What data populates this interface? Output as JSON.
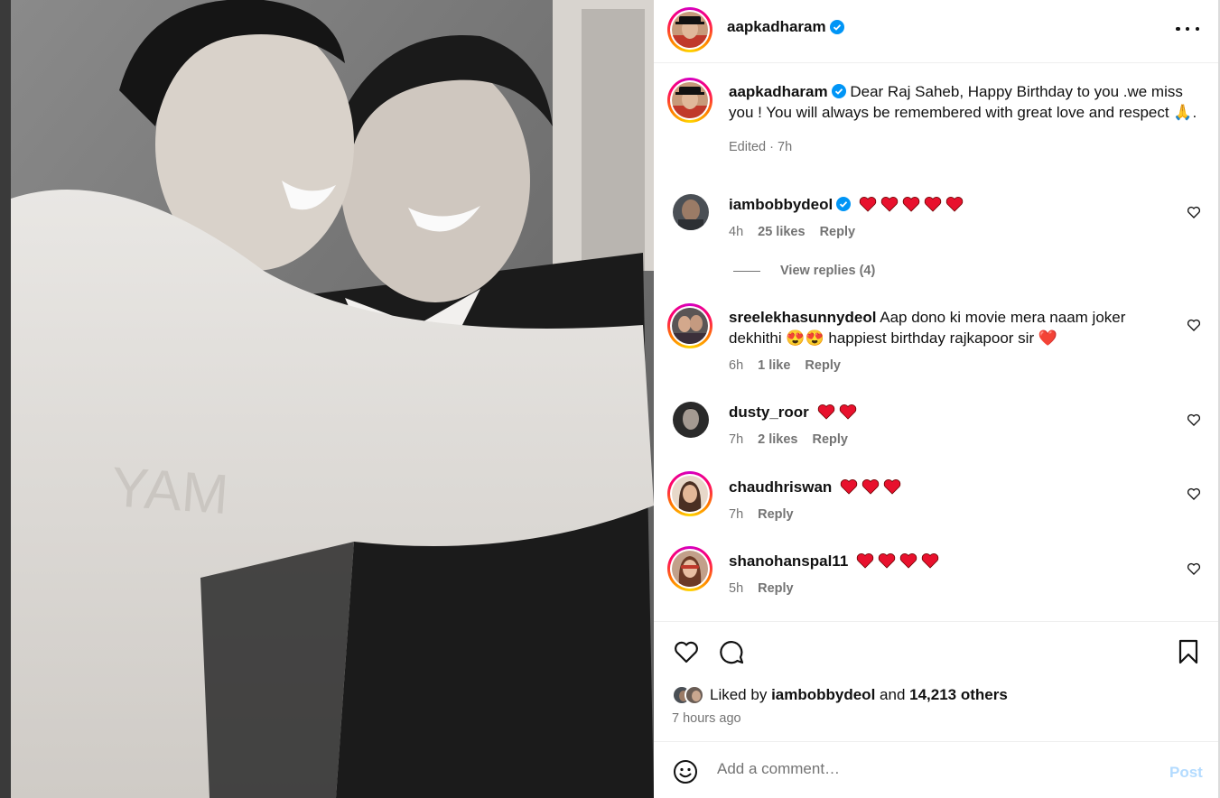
{
  "post": {
    "author": "aapkadharam",
    "caption_text": "Dear Raj Saheb, Happy Birthday to you .we miss you ! You will always be remembered with great love and respect 🙏.",
    "caption_meta": "Edited · 7h"
  },
  "comments": [
    {
      "user": "iambobbydeol",
      "verified": true,
      "text": "",
      "emoji": "❤️❤️❤️❤️❤️",
      "time": "4h",
      "likes": "25 likes",
      "reply": "Reply"
    },
    {
      "user": "sreelekhasunnydeol",
      "verified": false,
      "text": "Aap dono ki movie mera naam joker dekhithi 😍😍 happiest birthday rajkapoor sir ❤️",
      "time": "6h",
      "likes": "1 like",
      "reply": "Reply"
    },
    {
      "user": "dusty_roor",
      "verified": false,
      "emoji": "❤️❤️",
      "time": "7h",
      "likes": "2 likes",
      "reply": "Reply"
    },
    {
      "user": "chaudhriswan",
      "verified": false,
      "emoji": "❤️❤️❤️",
      "time": "7h",
      "reply": "Reply"
    },
    {
      "user": "shanohanspal11",
      "verified": false,
      "emoji": "❤️❤️❤️❤️",
      "time": "5h",
      "reply": "Reply"
    }
  ],
  "view_replies": "View replies (4)",
  "likes_summary": {
    "prefix": "Liked by",
    "user": "iambobbydeol",
    "mid": "and",
    "others": "14,213 others"
  },
  "timestamp": "7 hours ago",
  "add_comment": {
    "placeholder": "Add a comment…",
    "post_label": "Post"
  },
  "icons": {
    "like": "heart-icon",
    "comment": "comment-bubble-icon",
    "save": "bookmark-icon",
    "emoji": "smiley-icon",
    "more": "more-options-icon",
    "verified": "verified-badge-icon"
  },
  "colors": {
    "verified_blue": "#0095f6",
    "heart_red": "#e8112d",
    "muted_text": "#737373",
    "post_disabled": "#b3dbff"
  }
}
